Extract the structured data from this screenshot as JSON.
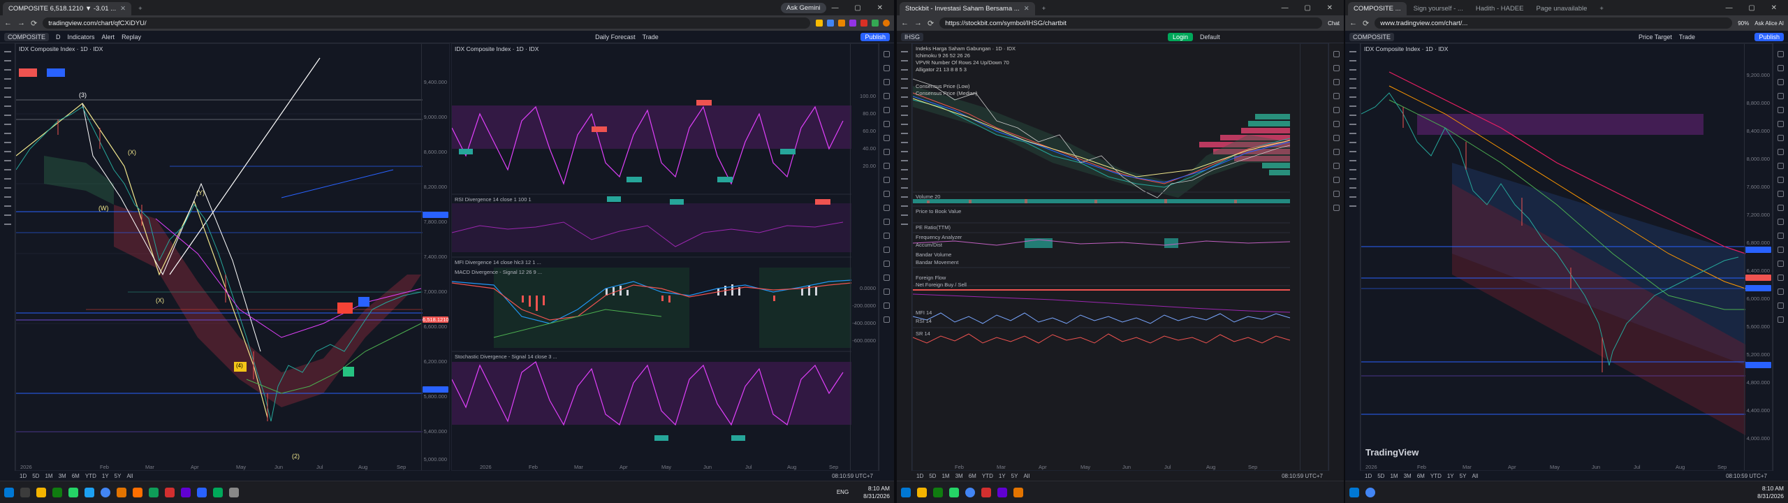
{
  "monitor1": {
    "tabs": [
      "COMPOSITE 6,518.1210 ▼ -3.01 ...",
      "+"
    ],
    "gemini": "Ask Gemini",
    "url": "tradingview.com/chart/qfCXiDYU/",
    "toolbar": {
      "symbol": "COMPOSITE",
      "interval": "D",
      "indicators": "Indicators",
      "alert": "Alert",
      "replay": "Replay",
      "layout": "Daily Forecast",
      "trade": "Trade",
      "publish": "Publish"
    },
    "left_chart": {
      "title": "IDX Composite Index · 1D · IDX",
      "prices": [
        "9,400.000",
        "9,000.000",
        "8,600.000",
        "8,200.000",
        "7,800.000",
        "7,400.000",
        "7,000.000",
        "6,600.000",
        "6,200.000",
        "5,800.000",
        "5,400.000",
        "5,000.000"
      ],
      "last_price": "6,518.1210",
      "wave_labels": [
        "(3)",
        "(X)",
        "(W)",
        "(Y)",
        "(X)",
        "(4)",
        "(2)"
      ],
      "dates": [
        "Feb",
        "Mar",
        "Apr",
        "May",
        "Jun",
        "Jul",
        "Aug",
        "Sep"
      ],
      "year": "2026"
    },
    "right_chart": {
      "title": "IDX Composite Index · 1D · IDX",
      "panes": [
        "RSI Divergence 14 close 1 100 1 ...",
        "RSI Divergence 14 close 1 100 1",
        "MFI Divergence 14 close hlc3 12 1 ...",
        "MACD Divergence - Signal 12 26 9 ...",
        "Stochastic Divergence - Signal 14 close 3 ..."
      ],
      "rsi_axis": [
        "100.00",
        "80.00",
        "60.00",
        "40.00",
        "20.00"
      ],
      "macd_axis": [
        "0.0000",
        "-200.0000",
        "-400.0000",
        "-600.0000"
      ],
      "dates": [
        "2026",
        "Feb",
        "Mar",
        "Apr",
        "May",
        "Jun",
        "Jul",
        "Aug",
        "Sep"
      ]
    },
    "ranges": [
      "1D",
      "5D",
      "1M",
      "3M",
      "6M",
      "YTD",
      "1Y",
      "5Y",
      "All"
    ],
    "time": "08:10:59 UTC+7"
  },
  "monitor2": {
    "tabs": [
      "Stockbit - Investasi Saham Bersama ...",
      "+"
    ],
    "url": "https://stockbit.com/symbol/IHSG/chartbit",
    "chat": "Chat",
    "symbol": "IHSG",
    "login": "Login",
    "default": "Default",
    "indicators": [
      "Indeks Harga Saham Gabungan · 1D · IDX",
      "Ichimoku 9 26 52 26 26",
      "VPVR Number Of Rows 24 Up/Down 70",
      "Alligator 21 13 8 8 5 3",
      "Consensus Price (Low)",
      "Consensus Price (Median)"
    ],
    "subpanes": [
      "Volume 20",
      "Price to Book Value",
      "PE Ratio(TTM)",
      "Frequency Analyzer",
      "Accum/Dist",
      "Bandar Volume",
      "Bandar Movement",
      "Foreign Flow",
      "Net Foreign Buy / Sell",
      "MFI 14",
      "RSI 14",
      "SR 14"
    ],
    "dates": [
      "Feb",
      "Mar",
      "Apr",
      "May",
      "Jun",
      "Jul",
      "Aug",
      "Sep"
    ],
    "ranges": [
      "1D",
      "5D",
      "1M",
      "3M",
      "6M",
      "YTD",
      "1Y",
      "5Y",
      "All"
    ],
    "time": "08:10:59 UTC+7"
  },
  "monitor3": {
    "tabs": [
      "COMPOSITE ...",
      "Sign yourself - ...",
      "Hadith - HADEE",
      "Page unavailable",
      "+"
    ],
    "url": "www.tradingview.com/chart/...",
    "zoom": "90%",
    "ask": "Ask Alice AI",
    "toolbar": {
      "symbol": "COMPOSITE",
      "price_target": "Price Target",
      "trade": "Trade",
      "publish": "Publish"
    },
    "title": "IDX Composite Index · 1D · IDX",
    "prices": [
      "9,200.000",
      "8,800.000",
      "8,400.000",
      "8,000.000",
      "7,600.000",
      "7,200.000",
      "6,800.000",
      "6,400.000",
      "6,000.000",
      "5,600.000",
      "5,200.000",
      "4,800.000",
      "4,400.000",
      "4,000.000"
    ],
    "brand": "TradingView",
    "dates": [
      "2026",
      "Feb",
      "Mar",
      "Apr",
      "May",
      "Jun",
      "Jul",
      "Aug",
      "Sep"
    ],
    "ranges": [
      "1D",
      "5D",
      "1M",
      "3M",
      "6M",
      "YTD",
      "1Y",
      "5Y",
      "All"
    ],
    "time": "08:10:59 UTC+7"
  },
  "taskbar": {
    "lang": "ENG",
    "time": "8:10 AM",
    "date": "8/31/2026"
  }
}
